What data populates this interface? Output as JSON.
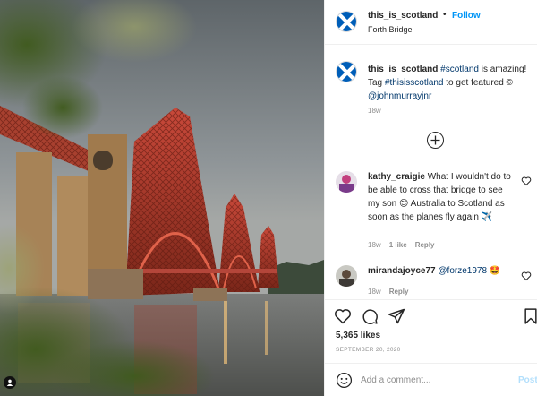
{
  "photo": {
    "alt_subject": "Forth Bridge at dusk"
  },
  "header": {
    "username": "this_is_scotland",
    "separator": "•",
    "follow_label": "Follow",
    "location": "Forth Bridge",
    "avatar_icon": "saltire-flag-icon"
  },
  "caption": {
    "username": "this_is_scotland",
    "hashtag1": "#scotland",
    "text1": " is amazing! Tag ",
    "hashtag2": "#thisisscotland",
    "text2": " to get featured © ",
    "mention": "@johnmurrayjnr",
    "time": "18w"
  },
  "load_more_icon": "plus-circle-icon",
  "comments": [
    {
      "username": "kathy_craigie",
      "text": "What I wouldn't do to be able to cross that bridge to see my son 😊 Australia to Scotland as soon as the planes fly again ✈️",
      "time": "18w",
      "likes": "1 like",
      "reply": "Reply"
    },
    {
      "username": "mirandajoyce77",
      "mention": "@forze1978",
      "emoji": "🤩",
      "time": "18w",
      "reply": "Reply"
    }
  ],
  "actions": {
    "icons": [
      "heart-icon",
      "comment-icon",
      "share-icon",
      "bookmark-icon"
    ]
  },
  "likes": "5,365 likes",
  "date": "SEPTEMBER 20, 2020",
  "add_comment": {
    "placeholder": "Add a comment...",
    "post_label": "Post"
  },
  "colors": {
    "follow": "#0095f6",
    "link": "#00376b",
    "muted": "#8e8e8e",
    "bridge": "#b83a2a",
    "post_disabled": "#b2dffc"
  }
}
